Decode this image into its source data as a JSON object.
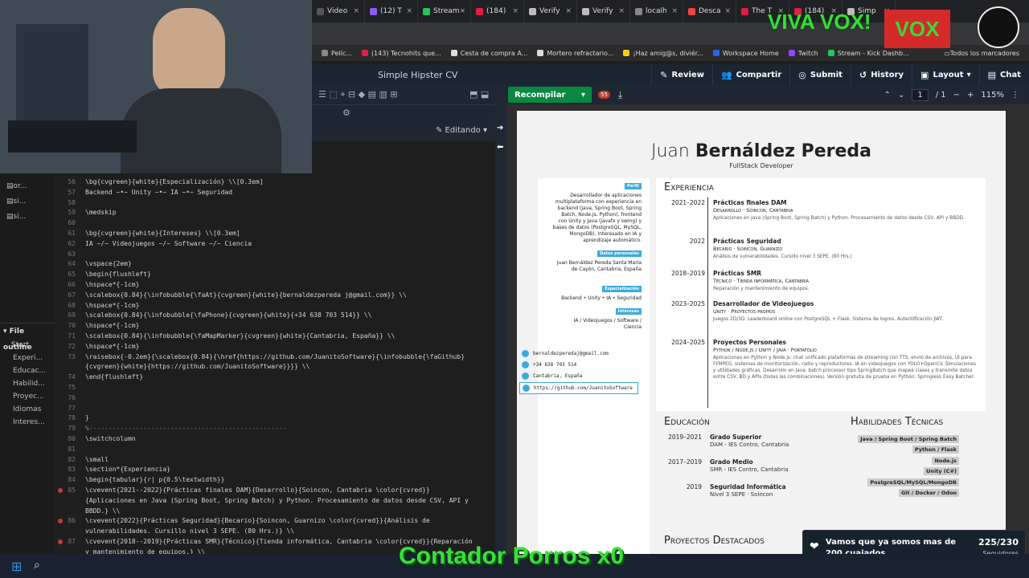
{
  "browser": {
    "tabs": [
      {
        "label": "Video",
        "color": "#555"
      },
      {
        "label": "(12) T",
        "color": "#8b5cf6"
      },
      {
        "label": "Stream",
        "color": "#22c55e"
      },
      {
        "label": "(184)",
        "color": "#e11d48"
      },
      {
        "label": "Verify",
        "color": "#bbb"
      },
      {
        "label": "Verify",
        "color": "#bbb"
      },
      {
        "label": "localh",
        "color": "#888"
      },
      {
        "label": "Desca",
        "color": "#ef4444"
      },
      {
        "label": "The T",
        "color": "#e11d48"
      },
      {
        "label": "(184)",
        "color": "#e11d48"
      },
      {
        "label": "Simp",
        "color": "#bbb"
      }
    ],
    "bookmarks": [
      {
        "label": "Pelíc...",
        "color": "#888"
      },
      {
        "label": "(143) Tecnohits que...",
        "color": "#e11d48"
      },
      {
        "label": "Cesta de compra A...",
        "color": "#ddd"
      },
      {
        "label": "Mortero refractario...",
        "color": "#ddd"
      },
      {
        "label": "¡Haz amig@s, diviér...",
        "color": "#facc15"
      },
      {
        "label": "Workspace Home",
        "color": "#2563eb"
      },
      {
        "label": "Twitch",
        "color": "#9146ff"
      },
      {
        "label": "Stream - Kick Dashb...",
        "color": "#22c55e"
      }
    ],
    "bookmarks_all": "Todos los marcadores"
  },
  "overleaf": {
    "title": "Simple Hipster CV",
    "buttons": {
      "review": "Review",
      "share": "Compartir",
      "submit": "Submit",
      "history": "History",
      "layout": "Layout",
      "chat": "Chat"
    },
    "compile": "Recompilar",
    "page_counter": "1",
    "page_total": "/ 1",
    "zoom": "115%",
    "editing": "Editando",
    "errors": "55",
    "file_outline": "File outline",
    "outline": [
      "Start",
      "Experi...",
      "Educac...",
      "Habilid...",
      "Proyec...",
      "Idiomas",
      "Interes..."
    ],
    "files": [
      "or...",
      "si...",
      "si..."
    ]
  },
  "code": [
    {
      "n": "56",
      "t": "\\bg{cvgreen}{white}{Especialización} \\\\[0.3em]"
    },
    {
      "n": "57",
      "t": "Backend ~•~ Unity ~•~ IA ~•~ Seguridad"
    },
    {
      "n": "58",
      "t": ""
    },
    {
      "n": "59",
      "t": "\\medskip"
    },
    {
      "n": "60",
      "t": ""
    },
    {
      "n": "61",
      "t": "\\bg{cvgreen}{white}{Intereses} \\\\[0.3em]"
    },
    {
      "n": "62",
      "t": "IA ~/~ Videojuegos ~/~ Software ~/~ Ciencia"
    },
    {
      "n": "63",
      "t": ""
    },
    {
      "n": "64",
      "t": "\\vspace{2em}"
    },
    {
      "n": "65",
      "t": "\\begin{flushleft}"
    },
    {
      "n": "66",
      "t": "\\hspace*{-1cm}"
    },
    {
      "n": "67",
      "t": "\\scalebox{0.84}{\\infobubble{\\faAt}{cvgreen}{white}{bernaldezpereda j@gmail.com}} \\\\"
    },
    {
      "n": "68",
      "t": "\\hspace*{-1cm}"
    },
    {
      "n": "69",
      "t": "\\scalebox{0.84}{\\infobubble{\\faPhone}{cvgreen}{white}{+34 638 703 514}} \\\\"
    },
    {
      "n": "70",
      "t": "\\hspace*{-1cm}"
    },
    {
      "n": "71",
      "t": "\\scalebox{0.84}{\\infobubble{\\faMapMarker}{cvgreen}{white}{Cantabria, España}} \\\\"
    },
    {
      "n": "72",
      "t": "\\hspace*{-1cm}"
    },
    {
      "n": "73",
      "t": "\\raisebox{-0.2em}{\\scalebox{0.84}{\\href{https://github.com/JuanitoSoftware}{\\infobubble{\\faGithub}"
    },
    {
      "n": "",
      "t": "{cvgreen}{white}{https://github.com/JuanitoSoftware}}}} \\\\"
    },
    {
      "n": "74",
      "t": "\\end{flushleft}"
    },
    {
      "n": "75",
      "t": ""
    },
    {
      "n": "76",
      "t": ""
    },
    {
      "n": "77",
      "t": ""
    },
    {
      "n": "78",
      "t": "}"
    },
    {
      "n": "79",
      "t": "%---------------------------------------------------"
    },
    {
      "n": "80",
      "t": "\\switchcolumn"
    },
    {
      "n": "81",
      "t": ""
    },
    {
      "n": "82",
      "t": "\\small"
    },
    {
      "n": "83",
      "t": "\\section*{Experiencia}"
    },
    {
      "n": "84",
      "t": "\\begin{tabular}{r| p{0.5\\textwidth}}"
    },
    {
      "n": "85",
      "t": "  \\cvevent{2021--2022}{Prácticas finales DAM}{Desarrollo}{Soincon, Cantabria \\color{cvred}}"
    },
    {
      "n": "",
      "t": "  {Aplicaciones en Java (Spring Boot, Spring Batch) y Python. Procesamiento de datos desde CSV, API y"
    },
    {
      "n": "",
      "t": "  BBDD.} \\\\"
    },
    {
      "n": "86",
      "t": "  \\cvevent{2022}{Prácticas Seguridad}{Becario}{Soincon, Guarnizo \\color{cvred}}{Análisis de"
    },
    {
      "n": "",
      "t": "  vulnerabilidades. Cursillo nivel 3 SEPE. (80 Hrs.)} \\\\"
    },
    {
      "n": "87",
      "t": "  \\cvevent{2018--2019}{Prácticas SMR}{Técnico}{Tienda informática, Cantabria \\color{cvred}}{Reparación"
    },
    {
      "n": "",
      "t": "  y mantenimiento de equipos.} \\\\"
    }
  ],
  "cv": {
    "name_light": "Juan ",
    "name_bold": "Bernáldez Pereda",
    "subtitle": "FullStack Developer",
    "profile_chip": "Perfil",
    "profile": "Desarrollador de aplicaciones multiplataforma con experiencia en backend (Java, Spring Boot, Spring Batch, Node.js, Python), frontend con Unity y Java (javafx y swing) y bases de datos (PostgreSQL, MySQL, MongoDB). Interesado en IA y aprendizaje automático.",
    "personal_chip": "Datos personales",
    "personal": "Juan Bernáldez Pereda Santa María de Cayón, Cantabria, España",
    "spec_chip": "Especialización",
    "spec": "Backend • Unity • IA • Seguridad",
    "int_chip": "Intereses",
    "interests": "IA / Videojuegos / Software / Ciencia",
    "email": "bernaldezperedaj@gmail.com",
    "phone": "+34 638 703 514",
    "location": "Cantabria, España",
    "github": "https://github.com/JuanitoSoftware",
    "exp_title": "Experiencia",
    "exp": [
      {
        "y": "2021–2022",
        "t": "Prácticas finales DAM",
        "s": "Desarrollo · Soincon, Cantabria",
        "d": "Aplicaciones en Java (Spring Boot, Spring Batch) y Python. Procesamiento de datos desde CSV, API y BBDD."
      },
      {
        "y": "2022",
        "t": "Prácticas Seguridad",
        "s": "Becario · Soincon, Guarnizo",
        "d": "Análisis de vulnerabilidades. Cursillo nivel 3 SEPE. (80 Hrs.)"
      },
      {
        "y": "2018–2019",
        "t": "Prácticas SMR",
        "s": "Técnico · Tienda informática, Cantabria",
        "d": "Reparación y mantenimiento de equipos."
      },
      {
        "y": "2023–2025",
        "t": "Desarrollador de Videojuegos",
        "s": "Unity · Proyectos propios",
        "d": "Juegos 2D/3D. Leaderboard online con PostgreSQL + Flask. Sistema de logros. Autentificación JWT."
      },
      {
        "y": "2024–2025",
        "t": "Proyectos Personales",
        "s": "Python / Node.js / Unity / Java · Portafolio",
        "d": "Aplicaciones en Python y Node.js: chat unificado plataformas de streaming con TTS, envío de archivos, UI para FFMPEG, sistemas de monitorización, radio y reproductores. IA en videojuegos con YOLO+OpenCV. Simulaciones y utilidades gráficas. Desarrollo en Java: batch processor tipo SpringBatch que mapea clases y transmite datos entre CSV, BD y APIs (todas las combinaciones). Versión gratuita de prueba en Python: Springless Easy Batcher."
      }
    ],
    "edu_title": "Educación",
    "edu": [
      {
        "y": "2019–2021",
        "t": "Grado Superior",
        "s": "DAM - IES Contro, Cantabria"
      },
      {
        "y": "2017–2019",
        "t": "Grado Medio",
        "s": "SMR - IES Contro, Cantabria"
      },
      {
        "y": "2019",
        "t": "Seguridad Informática",
        "s": "Nivel 3 SEPE · Soincon"
      }
    ],
    "skills_title": "Habilidades Técnicas",
    "skills": [
      "Java / Spring Boot / Spring Batch",
      "Python / Flask",
      "Node.js",
      "Unity (C#)",
      "PostgreSQL/MySQL/MongoDB",
      "Git / Docker / Odoo"
    ],
    "proj_title": "Proyectos Destacados"
  },
  "overlay": {
    "vox": "VIVA VOX!",
    "vox_logo": "VOX",
    "contador": "Contador Porros x0",
    "goal_text": "Vamos que ya somos mas de 200 cuajados",
    "goal_count": "225/230",
    "goal_label": "Seguidores",
    "goal_progress": 0.978
  }
}
